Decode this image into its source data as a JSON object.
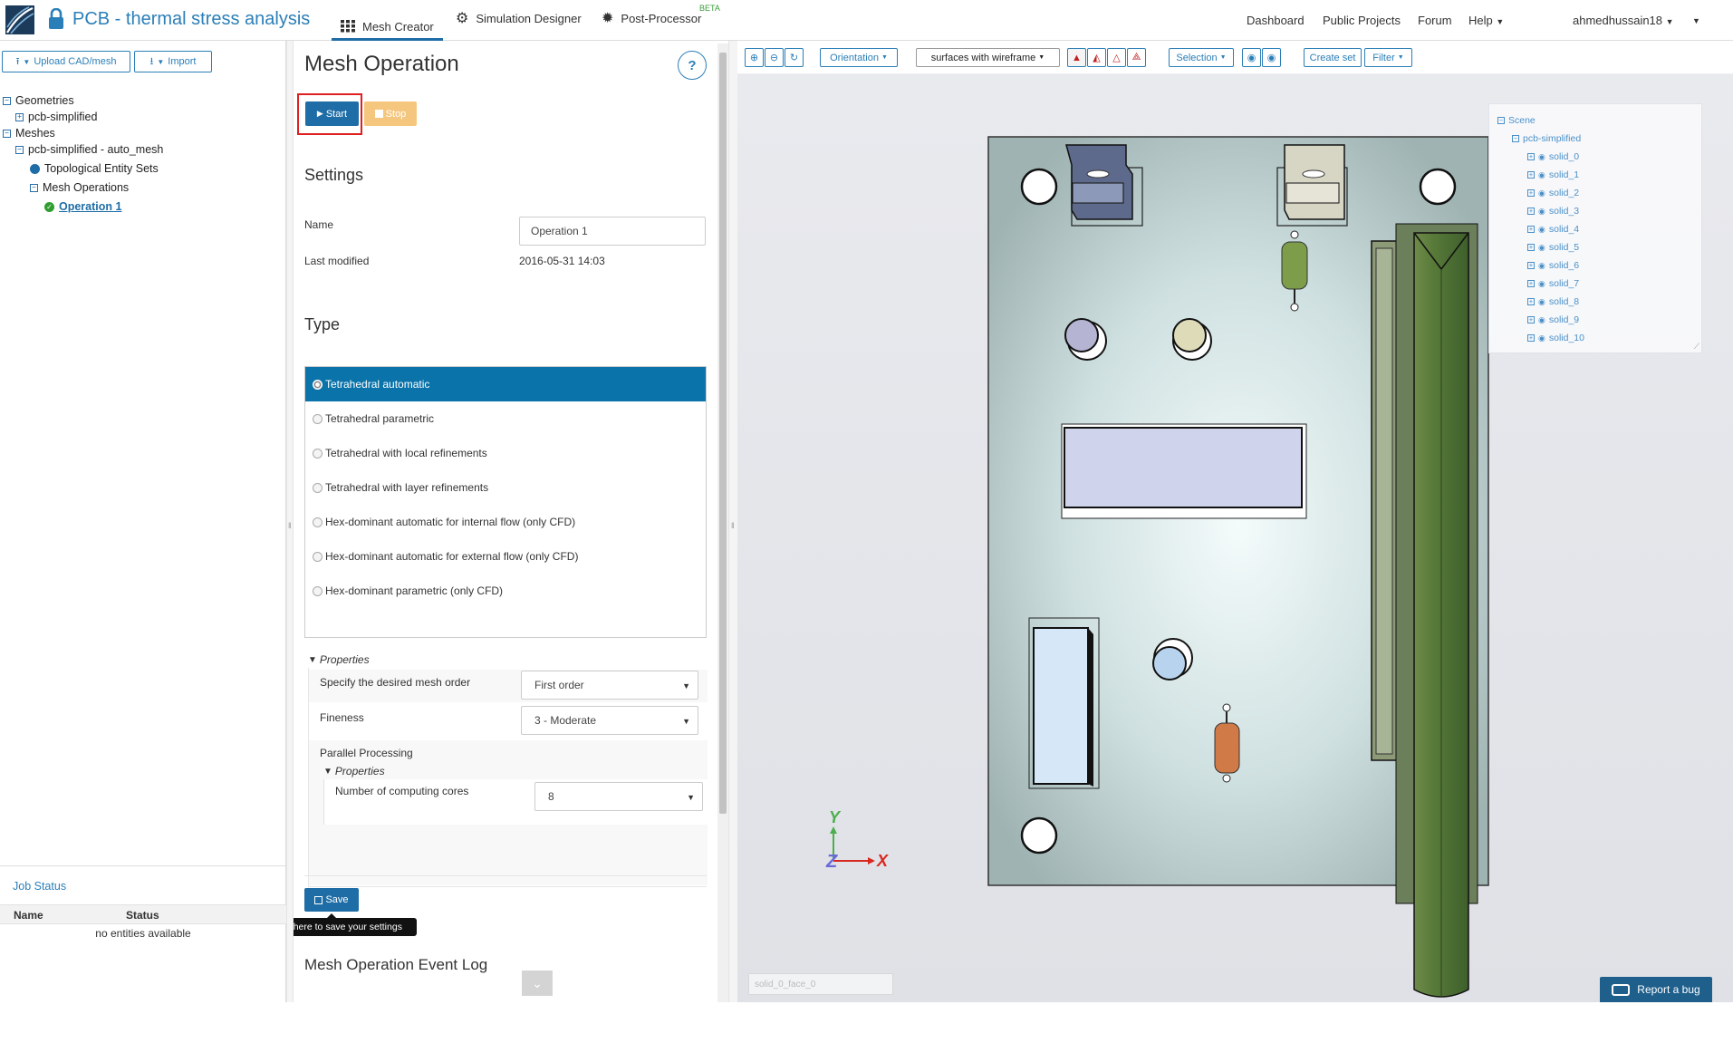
{
  "header": {
    "app_title": "PCB - thermal stress analysis",
    "tabs": [
      {
        "label": "Mesh Creator",
        "icon": "grid-icon"
      },
      {
        "label": "Simulation Designer",
        "icon": "gears-icon"
      },
      {
        "label": "Post-Processor",
        "icon": "gear-icon",
        "badge": "BETA"
      }
    ],
    "nav_links": [
      "Dashboard",
      "Public Projects",
      "Forum",
      "Help"
    ],
    "user": "ahmedhussain18"
  },
  "left_panel": {
    "upload_label": "Upload CAD/mesh",
    "import_label": "Import",
    "tree": {
      "geometries": "Geometries",
      "geometry_item": "pcb-simplified",
      "meshes": "Meshes",
      "mesh_item": "pcb-simplified - auto_mesh",
      "topo_sets": "Topological Entity Sets",
      "mesh_ops": "Mesh Operations",
      "operation": "Operation 1"
    },
    "job_status": {
      "title": "Job Status",
      "col_name": "Name",
      "col_status": "Status",
      "empty": "no entities available"
    }
  },
  "mesh_op": {
    "title": "Mesh Operation",
    "help": "?",
    "start_label": "Start",
    "stop_label": "Stop",
    "settings_title": "Settings",
    "name_label": "Name",
    "name_value": "Operation 1",
    "last_modified_label": "Last modified",
    "last_modified_value": "2016-05-31 14:03",
    "type_title": "Type",
    "types": [
      "Tetrahedral automatic",
      "Tetrahedral parametric",
      "Tetrahedral with local refinements",
      "Tetrahedral with layer refinements",
      "Hex-dominant automatic for internal flow (only CFD)",
      "Hex-dominant automatic for external flow (only CFD)",
      "Hex-dominant parametric (only CFD)"
    ],
    "properties_label": "Properties",
    "mesh_order_label": "Specify the desired mesh order",
    "mesh_order_value": "First order",
    "fineness_label": "Fineness",
    "fineness_value": "3 - Moderate",
    "parallel_label": "Parallel Processing",
    "sub_properties_label": "Properties",
    "cores_label": "Number of computing cores",
    "cores_value": "8",
    "save_label": "Save",
    "tooltip": "Click here to save your settings",
    "event_log_title": "Mesh Operation Event Log"
  },
  "viewer": {
    "toolbar": {
      "orientation": "Orientation",
      "render_mode": "surfaces with wireframe",
      "selection": "Selection",
      "create_set": "Create set",
      "filter": "Filter"
    },
    "scene": {
      "root": "Scene",
      "model": "pcb-simplified",
      "solids": [
        "solid_0",
        "solid_1",
        "solid_2",
        "solid_3",
        "solid_4",
        "solid_5",
        "solid_6",
        "solid_7",
        "solid_8",
        "solid_9",
        "solid_10"
      ]
    },
    "axis_y": "Y",
    "axis_z": "Z",
    "axis_x": "X",
    "face_input": "solid_0_face_0",
    "report_bug": "Report a bug"
  },
  "colors": {
    "accent": "#2b7fb8",
    "selected_row": "#0a73a9",
    "start_button": "#1e6da6",
    "stop_button": "#f5c77e",
    "highlight_box": "#e02020",
    "board_green": "#4a7035"
  }
}
